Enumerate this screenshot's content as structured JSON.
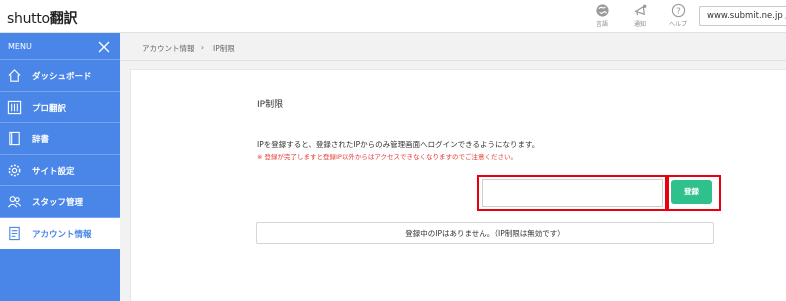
{
  "header": {
    "logo_brand": "shutto",
    "logo_suffix": "翻訳",
    "icons": [
      {
        "name": "language-icon",
        "label": "言語"
      },
      {
        "name": "notification-icon",
        "label": "通知"
      },
      {
        "name": "help-icon",
        "label": "ヘルプ"
      }
    ],
    "site_selector": "www.submit.ne.jp / :"
  },
  "sidebar": {
    "menu_label": "MENU",
    "items": [
      {
        "icon": "home-icon",
        "label": "ダッシュボード",
        "active": false
      },
      {
        "icon": "translation-icon",
        "label": "プロ翻訳",
        "active": false
      },
      {
        "icon": "dictionary-icon",
        "label": "辞書",
        "active": false
      },
      {
        "icon": "gear-icon",
        "label": "サイト設定",
        "active": false
      },
      {
        "icon": "staff-icon",
        "label": "スタッフ管理",
        "active": false
      },
      {
        "icon": "account-icon",
        "label": "アカウント情報",
        "active": true
      }
    ]
  },
  "breadcrumb": {
    "parent": "アカウント情報",
    "separator": "›",
    "current": "IP制限"
  },
  "main": {
    "title": "IP制限",
    "description": "IPを登録すると、登録されたIPからのみ管理画面へログインできるようになります。",
    "warning": "※ 登録が完了しますと登録IP以外からはアクセスできなくなりますのでご注意ください。",
    "ip_input_value": "",
    "ip_input_placeholder": "",
    "register_button": "登録",
    "status_message": "登録中のIPはありません。（IP制限は無効です）"
  },
  "colors": {
    "sidebar": "#4a86e8",
    "button": "#2fc18c",
    "highlight": "#e8000f",
    "warning": "#e53935"
  }
}
